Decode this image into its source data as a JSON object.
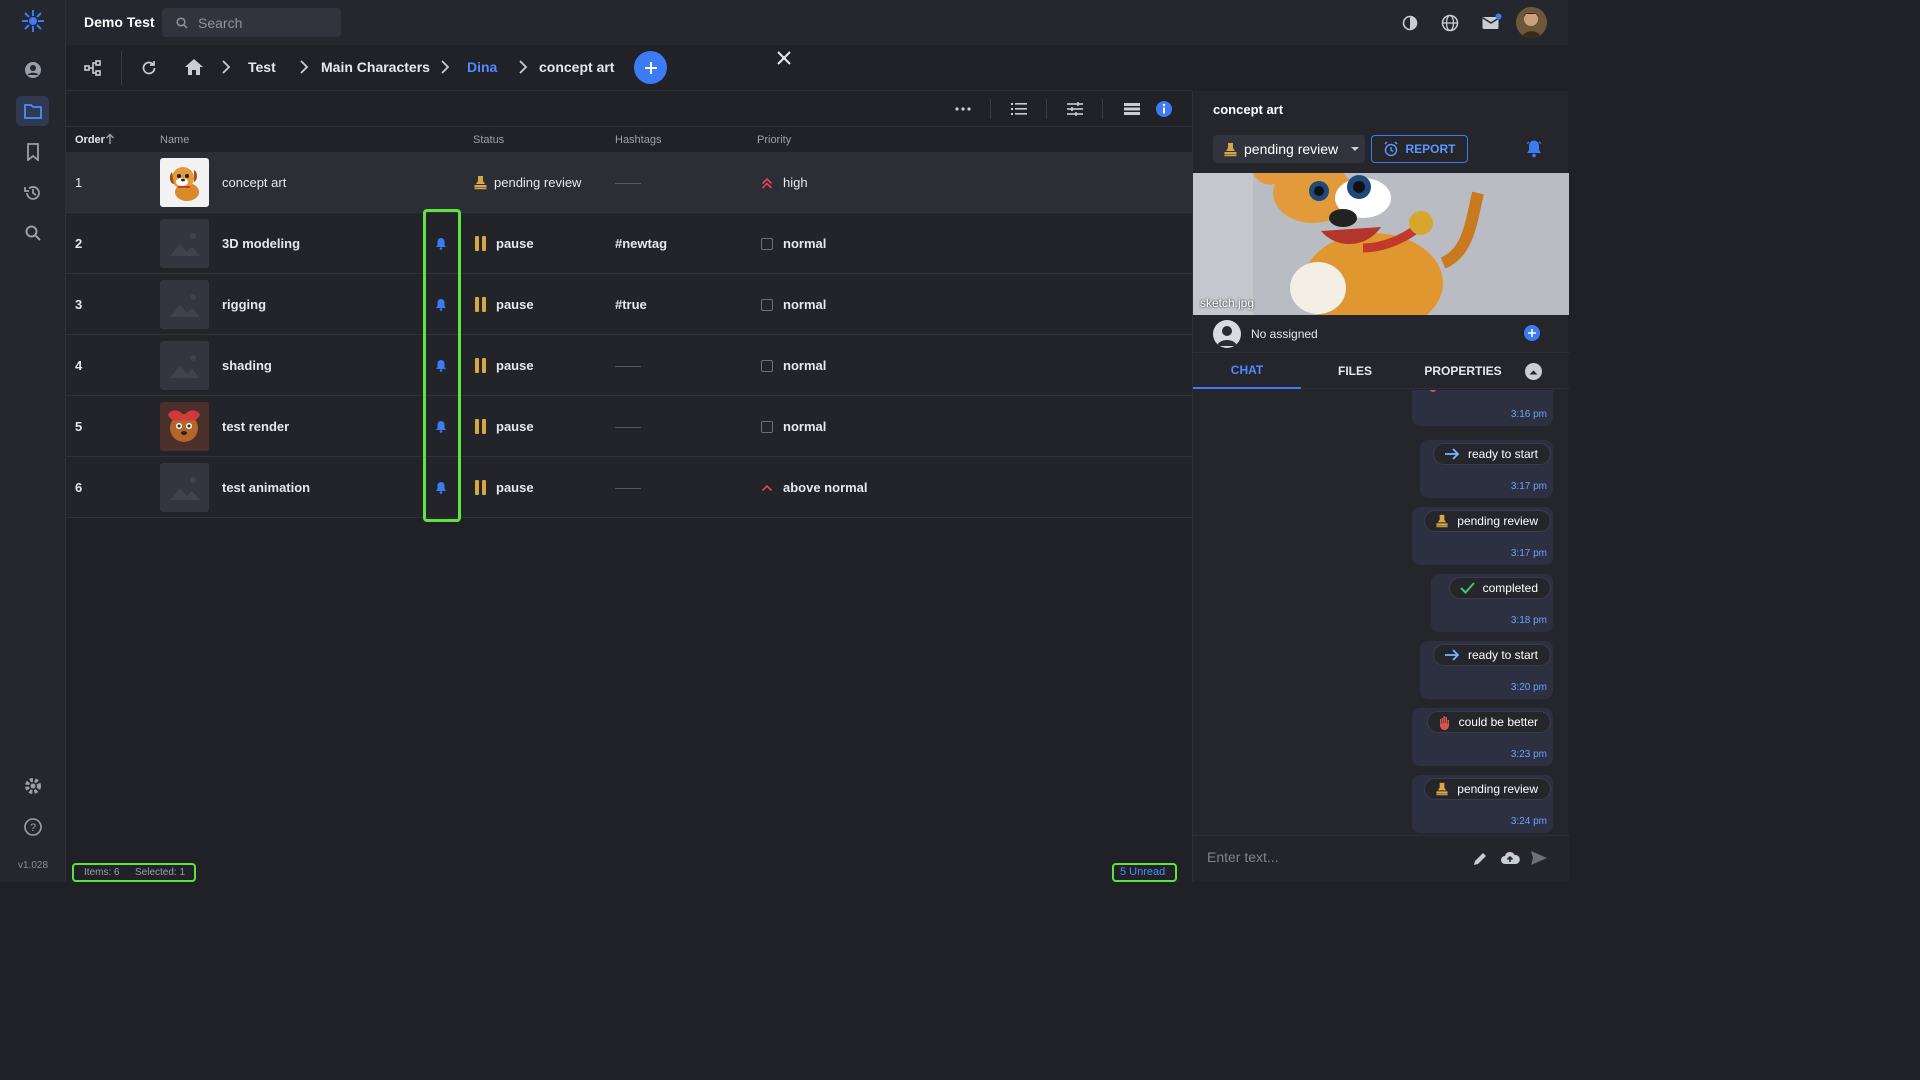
{
  "app": {
    "title": "Demo Test",
    "version": "v1.028"
  },
  "search": {
    "placeholder": "Search"
  },
  "breadcrumb": [
    "Test",
    "Main Characters",
    "Dina",
    "concept art"
  ],
  "table": {
    "headers": {
      "order": "Order",
      "name": "Name",
      "status": "Status",
      "hashtags": "Hashtags",
      "priority": "Priority"
    },
    "rows": [
      {
        "order": "1",
        "name": "concept art",
        "status": "pending review",
        "hashtag": "",
        "priority": "high",
        "thumb": "dog",
        "bell": false,
        "selected": true
      },
      {
        "order": "2",
        "name": "3D modeling",
        "status": "pause",
        "hashtag": "#newtag",
        "priority": "normal",
        "thumb": "placeholder",
        "bell": true
      },
      {
        "order": "3",
        "name": "rigging",
        "status": "pause",
        "hashtag": "#true",
        "priority": "normal",
        "thumb": "placeholder",
        "bell": true
      },
      {
        "order": "4",
        "name": "shading",
        "status": "pause",
        "hashtag": "",
        "priority": "normal",
        "thumb": "placeholder",
        "bell": true
      },
      {
        "order": "5",
        "name": "test render",
        "status": "pause",
        "hashtag": "",
        "priority": "normal",
        "thumb": "render",
        "bell": true
      },
      {
        "order": "6",
        "name": "test animation",
        "status": "pause",
        "hashtag": "",
        "priority": "above normal",
        "thumb": "placeholder",
        "bell": true
      }
    ]
  },
  "statusbar": {
    "items": "Items: 6",
    "selected": "Selected: 1",
    "unread": "5 Unread"
  },
  "panel": {
    "title": "concept art",
    "status": "pending review",
    "report_label": "REPORT",
    "preview_label": "sketch.jpg",
    "assignee": "No assigned",
    "tabs": [
      "CHAT",
      "FILES",
      "PROPERTIES"
    ],
    "input_placeholder": "Enter text...",
    "messages": [
      {
        "text": "",
        "time": "3:16 pm",
        "icon": "hand"
      },
      {
        "text": "ready to start",
        "time": "3:17 pm",
        "icon": "arrow"
      },
      {
        "text": "pending review",
        "time": "3:17 pm",
        "icon": "stamp"
      },
      {
        "text": "completed",
        "time": "3:18 pm",
        "icon": "check"
      },
      {
        "text": "ready to start",
        "time": "3:20 pm",
        "icon": "arrow"
      },
      {
        "text": "could be better",
        "time": "3:23 pm",
        "icon": "hand"
      },
      {
        "text": "pending review",
        "time": "3:24 pm",
        "icon": "stamp"
      }
    ]
  },
  "colors": {
    "accent": "#3b7cf6",
    "highlight": "#5ee33f",
    "pause": "#d6a844",
    "priority_high": "#e0455a"
  }
}
